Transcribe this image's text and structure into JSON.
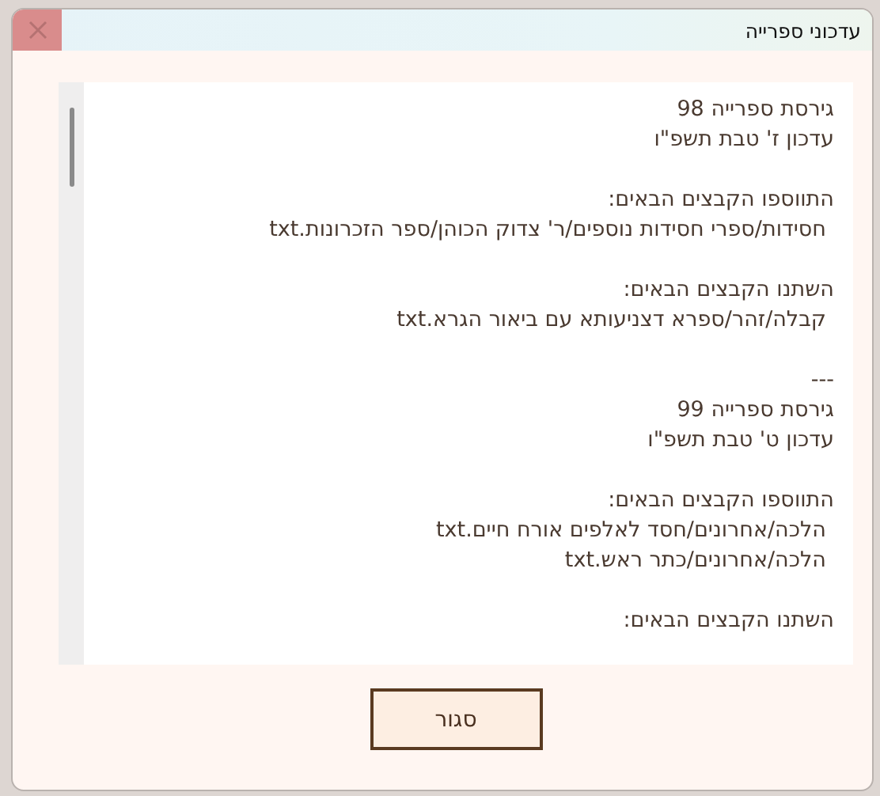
{
  "window": {
    "title": "עדכוני ספרייה"
  },
  "paragraphs": [
    [
      {
        "text": "גירסת ספרייה 98",
        "kind": "plain"
      },
      {
        "text": "עדכון ז' טבת תשפ\"ו",
        "kind": "plain"
      }
    ],
    [
      {
        "text": "התווספו הקבצים הבאים:",
        "kind": "plain"
      },
      {
        "text": "חסידות/ספרי חסידות נוספים/ר' צדוק הכוהן/ספר הזכרונות.txt",
        "kind": "file"
      }
    ],
    [
      {
        "text": "השתנו הקבצים הבאים:",
        "kind": "plain"
      },
      {
        "text": "קבלה/זהר/ספרא דצניעותא עם ביאור הגרא.txt",
        "kind": "file"
      }
    ],
    [
      {
        "text": "---",
        "kind": "plain"
      },
      {
        "text": "גירסת ספרייה 99",
        "kind": "plain"
      },
      {
        "text": "עדכון ט' טבת תשפ\"ו",
        "kind": "plain"
      }
    ],
    [
      {
        "text": "התווספו הקבצים הבאים:",
        "kind": "plain"
      },
      {
        "text": "הלכה/אחרונים/חסד לאלפים אורח חיים.txt",
        "kind": "file"
      },
      {
        "text": "הלכה/אחרונים/כתר ראש.txt",
        "kind": "file"
      }
    ],
    [
      {
        "text": "השתנו הקבצים הבאים:",
        "kind": "plain"
      }
    ]
  ],
  "buttons": [
    {
      "label": "סגור"
    }
  ]
}
